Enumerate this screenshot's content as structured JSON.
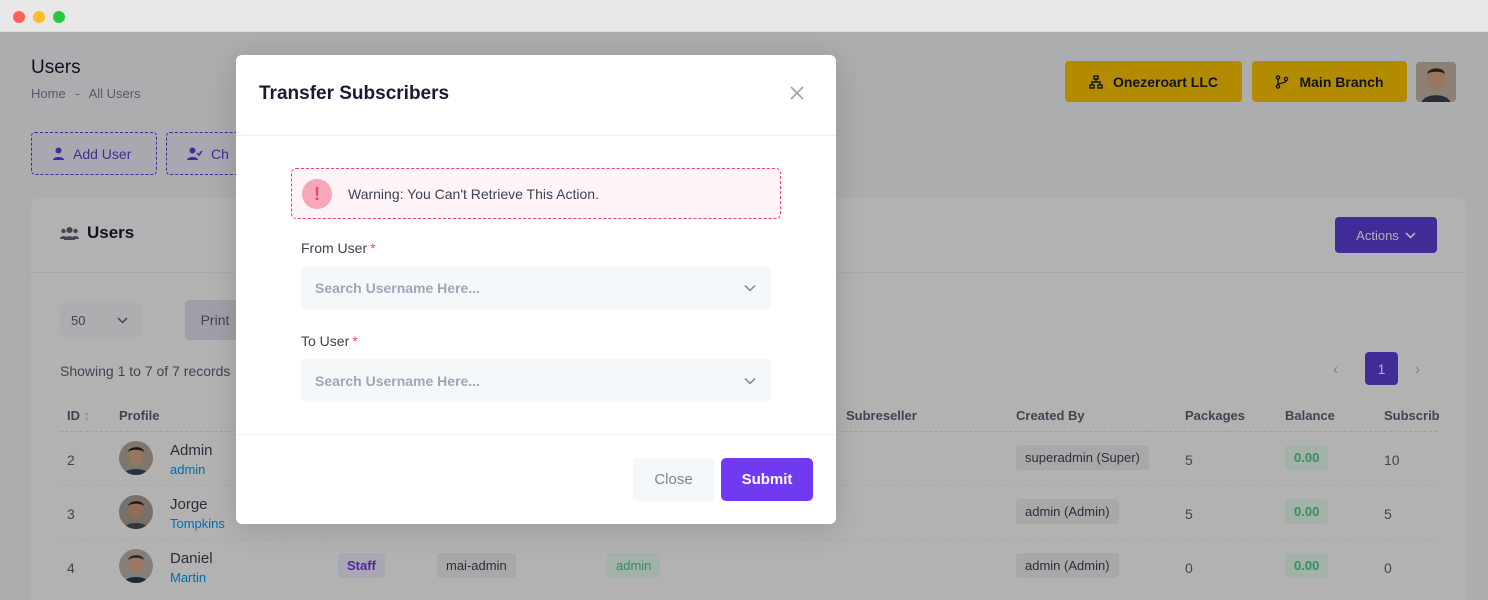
{
  "window": {
    "controls": [
      "close",
      "minimize",
      "zoom"
    ]
  },
  "header": {
    "title": "Users",
    "breadcrumb": [
      "Home",
      "-",
      "All Users"
    ],
    "company_button": "Onezeroart LLC",
    "branch_button": "Main Branch",
    "avatar_icon": "user-avatar"
  },
  "toolbar": {
    "add_user": "Add User",
    "change": "Ch"
  },
  "card": {
    "title": "Users",
    "actions_label": "Actions",
    "page_size": "50",
    "print_label": "Print",
    "showing": "Showing 1 to 7 of 7 records",
    "current_page": "1"
  },
  "table": {
    "columns": [
      "ID",
      "Profile",
      "Subreseller",
      "Created By",
      "Packages",
      "Balance",
      "Subscrib"
    ],
    "rows": [
      {
        "id": "2",
        "first": "Admin",
        "last": "admin",
        "role": "",
        "group": "",
        "subreseller": "",
        "created_by": "superadmin (Super)",
        "packages": "5",
        "balance": "0.00",
        "subscribers": "10"
      },
      {
        "id": "3",
        "first": "Jorge",
        "last": "Tompkins",
        "role": "",
        "group": "",
        "subreseller": "",
        "created_by": "admin (Admin)",
        "packages": "5",
        "balance": "0.00",
        "subscribers": "5"
      },
      {
        "id": "4",
        "first": "Daniel",
        "last": "Martin",
        "role": "Staff",
        "group": "mai-admin",
        "subreseller": "admin",
        "created_by": "admin (Admin)",
        "packages": "0",
        "balance": "0.00",
        "subscribers": "0"
      }
    ]
  },
  "modal": {
    "title": "Transfer Subscribers",
    "warning": "Warning: You Can't Retrieve This Action.",
    "from_label": "From User",
    "to_label": "To User",
    "required_mark": "*",
    "from_placeholder": "Search Username Here...",
    "to_placeholder": "Search Username Here...",
    "close_label": "Close",
    "submit_label": "Submit"
  },
  "colors": {
    "primary": "#5d3ed8",
    "warning_yellow": "#ffc700",
    "danger": "#f1416c",
    "success": "#50cd89"
  }
}
